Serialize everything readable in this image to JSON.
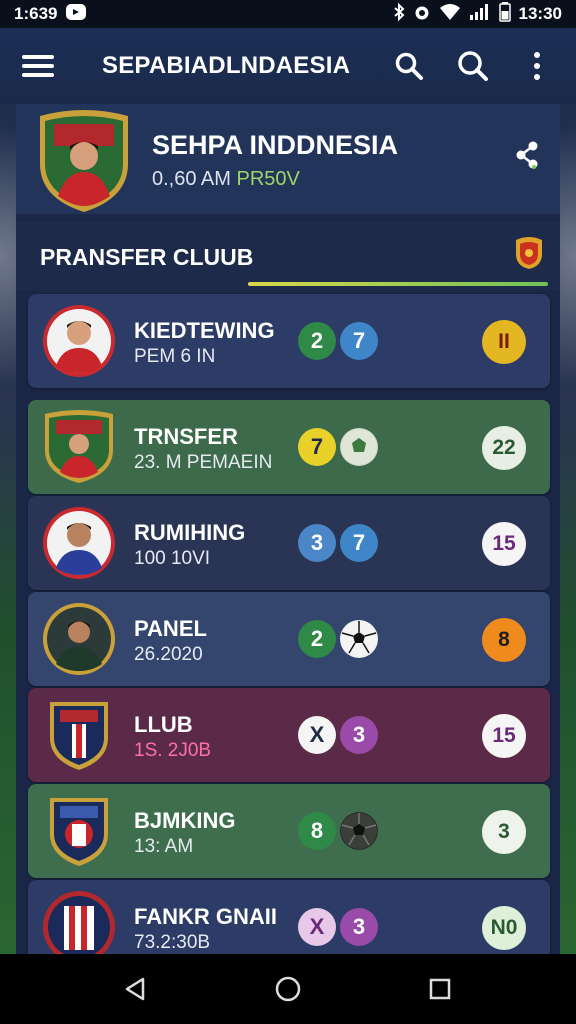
{
  "status_bar": {
    "time_left": "1:639",
    "time_right": "13:30",
    "icons": [
      "notification-icon",
      "bluetooth-icon",
      "alarm-icon",
      "wifi-icon",
      "signal-icon",
      "battery-icon"
    ]
  },
  "app_bar": {
    "title": "SEPABIADLNDAESIA",
    "icons": [
      "menu-icon",
      "search-icon",
      "search-icon",
      "more-vertical-icon"
    ]
  },
  "profile": {
    "title": "SEHPA INDDNESIA",
    "sub_time": "0.,60 AM",
    "sub_accent": "PR50V"
  },
  "section": {
    "title": "PRANSFER CLUUB"
  },
  "rows": [
    {
      "name": "KIEDTEWING",
      "sub": "PEM 6 IN",
      "stat_a": "2",
      "stat_b": "7",
      "score": "II"
    },
    {
      "name": "TRNSFER",
      "sub": "23. M PEMAEIN",
      "stat_a": "7",
      "stat_b": "",
      "score": "22"
    },
    {
      "name": "RUMIHING",
      "sub": "100 10VI",
      "stat_a": "3",
      "stat_b": "7",
      "score": "15"
    },
    {
      "name": "PANEL",
      "sub": "26.2020",
      "stat_a": "2",
      "stat_b": "",
      "score": "8"
    },
    {
      "name": "LLUB",
      "sub": "1S. 2J0B",
      "stat_a": "X",
      "stat_b": "3",
      "score": "15"
    },
    {
      "name": "BJMKING",
      "sub": "13: AM",
      "stat_a": "8",
      "stat_b": "",
      "score": "3"
    },
    {
      "name": "FANKR GNAII",
      "sub": "73.2:30B",
      "stat_a": "X",
      "stat_b": "3",
      "score": "N0"
    }
  ],
  "colors": {
    "panel": "#1a2747",
    "accent_green": "#9fd46a",
    "row_blue": "#2c3c66",
    "row_green": "#3c6a4a",
    "row_maroon": "#5a2a48"
  }
}
